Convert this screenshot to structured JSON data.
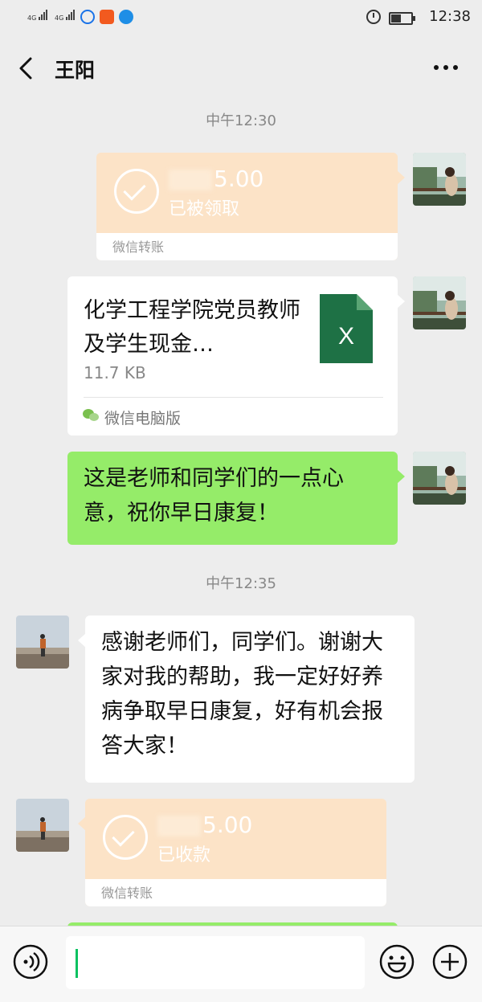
{
  "status_bar": {
    "net1": "4G",
    "net2": "4G",
    "time": "12:38"
  },
  "header": {
    "title": "王阳"
  },
  "messages": {
    "time1": "中午12:30",
    "transfer1": {
      "amount": "5.00",
      "status": "已被领取",
      "footer": "微信转账"
    },
    "file": {
      "name": "化学工程学院党员教师及学生现金…",
      "size": "11.7 KB",
      "source": "微信电脑版",
      "type_letter": "X"
    },
    "text1": "这是老师和同学们的一点心意，祝你早日康复！",
    "time2": "中午12:35",
    "text2": "感谢老师们，同学们。谢谢大家对我的帮助，我一定好好养病争取早日康复，好有机会报答大家！",
    "transfer2": {
      "amount": "5.00",
      "status": "已收款",
      "footer": "微信转账"
    }
  },
  "input": {
    "value": ""
  },
  "colors": {
    "bubble_green": "#95ec69",
    "transfer_orange": "#fce3c7",
    "excel_green": "#1e7145",
    "caret_green": "#07c160"
  }
}
